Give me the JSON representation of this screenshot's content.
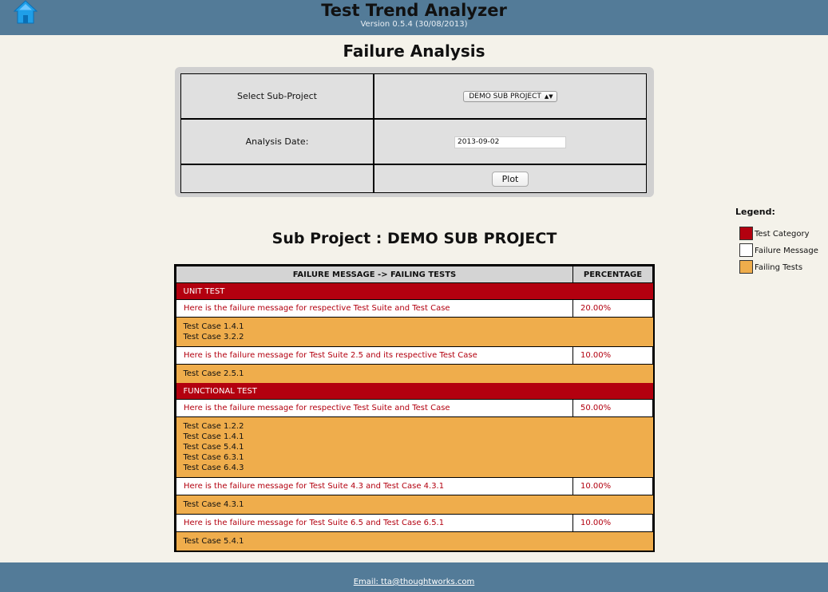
{
  "header": {
    "title": "Test Trend Analyzer",
    "version": "Version 0.5.4 (30/08/2013)",
    "home_icon": "home-icon"
  },
  "page": {
    "title": "Failure Analysis"
  },
  "form": {
    "sub_project_label": "Select Sub-Project",
    "sub_project_value": "DEMO SUB PROJECT",
    "date_label": "Analysis Date:",
    "date_value": "2013-09-02",
    "plot_label": "Plot"
  },
  "legend": {
    "title": "Legend:",
    "items": [
      {
        "label": "Test Category",
        "color": "#b3000f"
      },
      {
        "label": "Failure Message",
        "color": "#ffffff"
      },
      {
        "label": "Failing Tests",
        "color": "#efad4c"
      }
    ]
  },
  "results": {
    "title": "Sub Project : DEMO SUB PROJECT",
    "header_message": "FAILURE MESSAGE -> FAILING TESTS",
    "header_percentage": "PERCENTAGE",
    "categories": [
      {
        "name": "UNIT TEST",
        "failures": [
          {
            "message": "Here is the failure message for respective Test Suite and Test Case",
            "percentage": "20.00%",
            "tests": [
              "Test Case 1.4.1",
              "Test Case 3.2.2"
            ]
          },
          {
            "message": "Here is the failure message for Test Suite 2.5 and its respective Test Case",
            "percentage": "10.00%",
            "tests": [
              "Test Case 2.5.1"
            ]
          }
        ]
      },
      {
        "name": "FUNCTIONAL TEST",
        "failures": [
          {
            "message": "Here is the failure message for respective Test Suite and Test Case",
            "percentage": "50.00%",
            "tests": [
              "Test Case 1.2.2",
              "Test Case 1.4.1",
              "Test Case 5.4.1",
              "Test Case 6.3.1",
              "Test Case 6.4.3"
            ]
          },
          {
            "message": "Here is the failure message for Test Suite 4.3 and Test Case 4.3.1",
            "percentage": "10.00%",
            "tests": [
              "Test Case 4.3.1"
            ]
          },
          {
            "message": "Here is the failure message for Test Suite 6.5 and Test Case 6.5.1",
            "percentage": "10.00%",
            "tests": [
              "Test Case 5.4.1"
            ]
          }
        ]
      }
    ]
  },
  "footer": {
    "email": "Email: tta@thoughtworks.com"
  }
}
